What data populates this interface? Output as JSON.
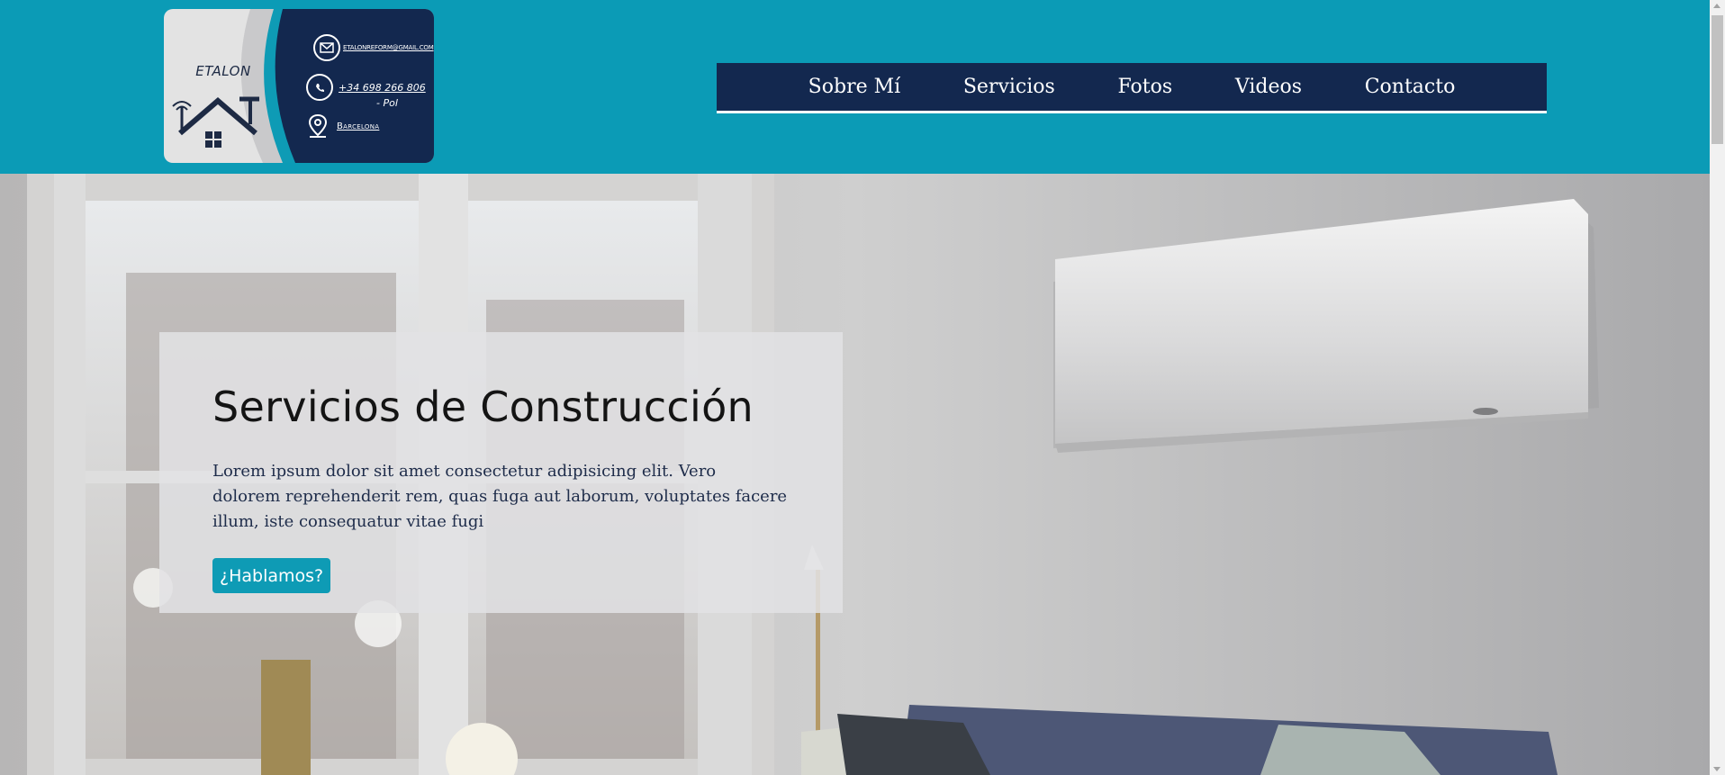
{
  "logo": {
    "brand": "ETALON",
    "email": "ETALONREFORM@GMAIL.COM",
    "phone": "+34 698 266 806",
    "contact_name": "- Pol",
    "city": "Barcelona",
    "icons": [
      "house-tools-icon",
      "mail-icon",
      "whatsapp-icon",
      "location-pin-icon"
    ]
  },
  "nav": {
    "items": [
      {
        "label": "Sobre Mí"
      },
      {
        "label": "Servicios"
      },
      {
        "label": "Fotos"
      },
      {
        "label": "Videos"
      },
      {
        "label": "Contacto"
      }
    ]
  },
  "hero": {
    "title": "Servicios de Construcción",
    "text": "Lorem ipsum dolor sit amet consectetur adipisicing elit. Vero dolorem reprehenderit rem, quas fuga aut laborum, voluptates facere illum, iste consequatur vitae fugi",
    "cta_label": "¿Hablamos?"
  },
  "colors": {
    "header_bg": "#0b9bb6",
    "nav_bg": "#13284f",
    "nav_text": "#ffffff",
    "button_bg": "#0e9bb5",
    "card_text": "#1e2c4a"
  }
}
